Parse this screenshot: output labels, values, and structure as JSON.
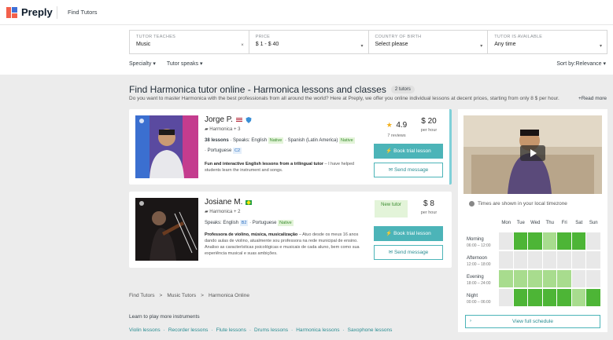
{
  "header": {
    "brand": "Preply",
    "find_tutors": "Find Tutors"
  },
  "filters": [
    {
      "label": "TUTOR TEACHES",
      "value": "Music",
      "control": "×"
    },
    {
      "label": "PRICE",
      "value": "$ 1 - $ 40",
      "control": "▾"
    },
    {
      "label": "COUNTRY OF BIRTH",
      "value": "Select please",
      "control": "▾"
    },
    {
      "label": "TUTOR IS AVAILABLE",
      "value": "Any time",
      "control": "▾"
    }
  ],
  "subfilters": {
    "specialty": "Specialty ▾",
    "tutor_speaks": "Tutor speaks ▾",
    "sort": "Sort by:Relevance ▾"
  },
  "page": {
    "title": "Find Harmonica tutor online - Harmonica lessons and classes",
    "count": "2 tutors",
    "intro": "Do you want to master Harmonica with the best professionals from all around the world? Here at Preply, we offer you online individual lessons at decent prices, starting from only 8 $ per hour.",
    "read_more": "+Read more"
  },
  "tutors": [
    {
      "name": "Jorge P.",
      "subject": "Harmonica + 3",
      "lessons": "38 lessons",
      "speaks_label": "· Speaks: English",
      "lang1_level": "Native",
      "lang2": "· Spanish (Latin America)",
      "lang2_level": "Native",
      "lang3": "· Portuguese",
      "lang3_level": "C2",
      "desc_bold": "Fun and interactive English lessons from a trilingual tutor",
      "desc": " – I have helped students learn the instrument and songs.",
      "rating": "4.9",
      "reviews": "7 reviews",
      "price": "$ 20",
      "per_hour": "per hour",
      "book": "⚡ Book trial lesson",
      "message": "✉ Send message"
    },
    {
      "name": "Josiane M.",
      "subject": "Harmonica + 2",
      "speaks_label": "Speaks: English",
      "lang1_level": "B2",
      "lang2": "· Portuguese",
      "lang2_level": "Native",
      "desc_bold": "Professora de violino, música, musicalização",
      "desc": " – Atuo desde os meus 16 anos dando aulas de violino, atualmente sou professora na rede municipal de ensino. Analiso as características psicológicas e musicais de cada aluno, bem como sua experiência musical e suas ambições.",
      "new_tutor": "New tutor",
      "price": "$ 8",
      "per_hour": "per hour",
      "book": "⚡ Book trial lesson",
      "message": "✉ Send message"
    }
  ],
  "schedule": {
    "timezone_note": "Times are shown in your local timezone",
    "days": [
      "Mon",
      "Tue",
      "Wed",
      "Thu",
      "Fri",
      "Sat",
      "Sun"
    ],
    "slots": [
      {
        "name": "Morning",
        "time": "06:00 – 12:00",
        "levels": [
          0,
          2,
          2,
          1,
          2,
          2,
          0
        ]
      },
      {
        "name": "Afternoon",
        "time": "12:00 – 18:00",
        "levels": [
          0,
          0,
          0,
          0,
          0,
          0,
          0
        ]
      },
      {
        "name": "Evening",
        "time": "18:00 – 24:00",
        "levels": [
          1,
          1,
          1,
          1,
          1,
          0,
          0
        ]
      },
      {
        "name": "Night",
        "time": "00:00 – 06:00",
        "levels": [
          0,
          2,
          2,
          2,
          2,
          1,
          2
        ]
      }
    ],
    "view_full": "View full schedule",
    "colors": {
      "none": "#e8e8e8",
      "partial": "#a8dc8e",
      "full": "#4db536"
    }
  },
  "breadcrumb": [
    "Find Tutors",
    ">",
    "Music Tutors",
    ">",
    "Harmonica Online"
  ],
  "learn_more": {
    "heading": "Learn to play more instruments",
    "items": [
      "Violin lessons",
      "·",
      "Recorder lessons",
      "·",
      "Flute lessons",
      "·",
      "Drums lessons",
      "·",
      "Harmonica lessons",
      "·",
      "Saxophone lessons"
    ]
  }
}
